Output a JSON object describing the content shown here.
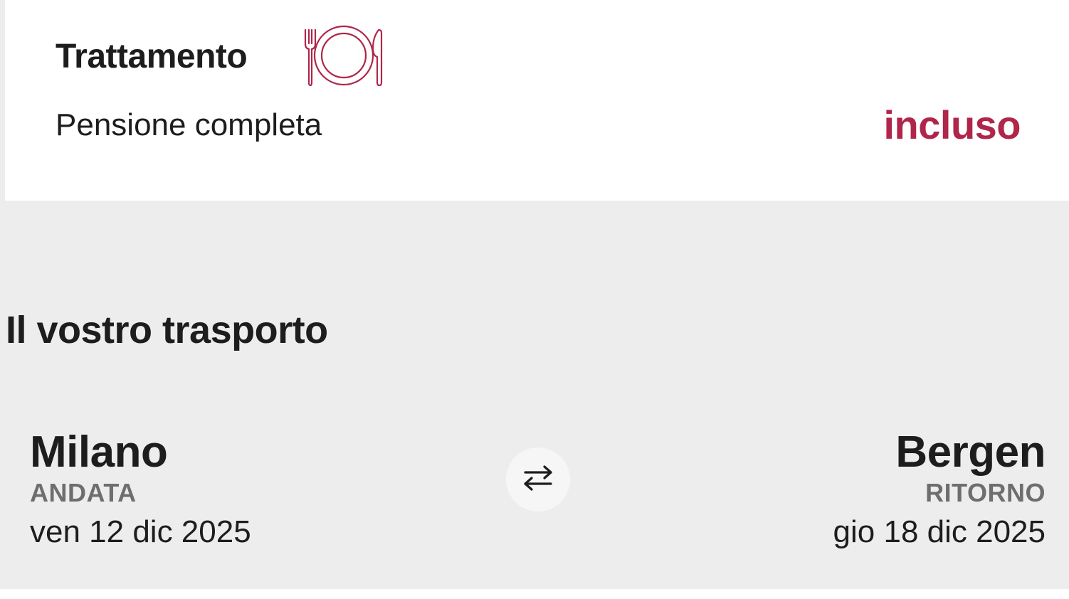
{
  "board": {
    "title": "Trattamento",
    "icon": "dining-plate-icon",
    "value": "Pensione completa",
    "status": "incluso"
  },
  "transport": {
    "heading": "Il vostro trasporto",
    "swap_icon": "swap-arrows-icon",
    "outbound": {
      "city": "Milano",
      "type": "ANDATA",
      "date": "ven 12 dic 2025"
    },
    "return": {
      "city": "Bergen",
      "type": "RITORNO",
      "date": "gio 18 dic 2025"
    }
  },
  "colors": {
    "accent": "#b0264a",
    "background": "#ededed",
    "card": "#ffffff",
    "muted": "#6e6e6e"
  }
}
